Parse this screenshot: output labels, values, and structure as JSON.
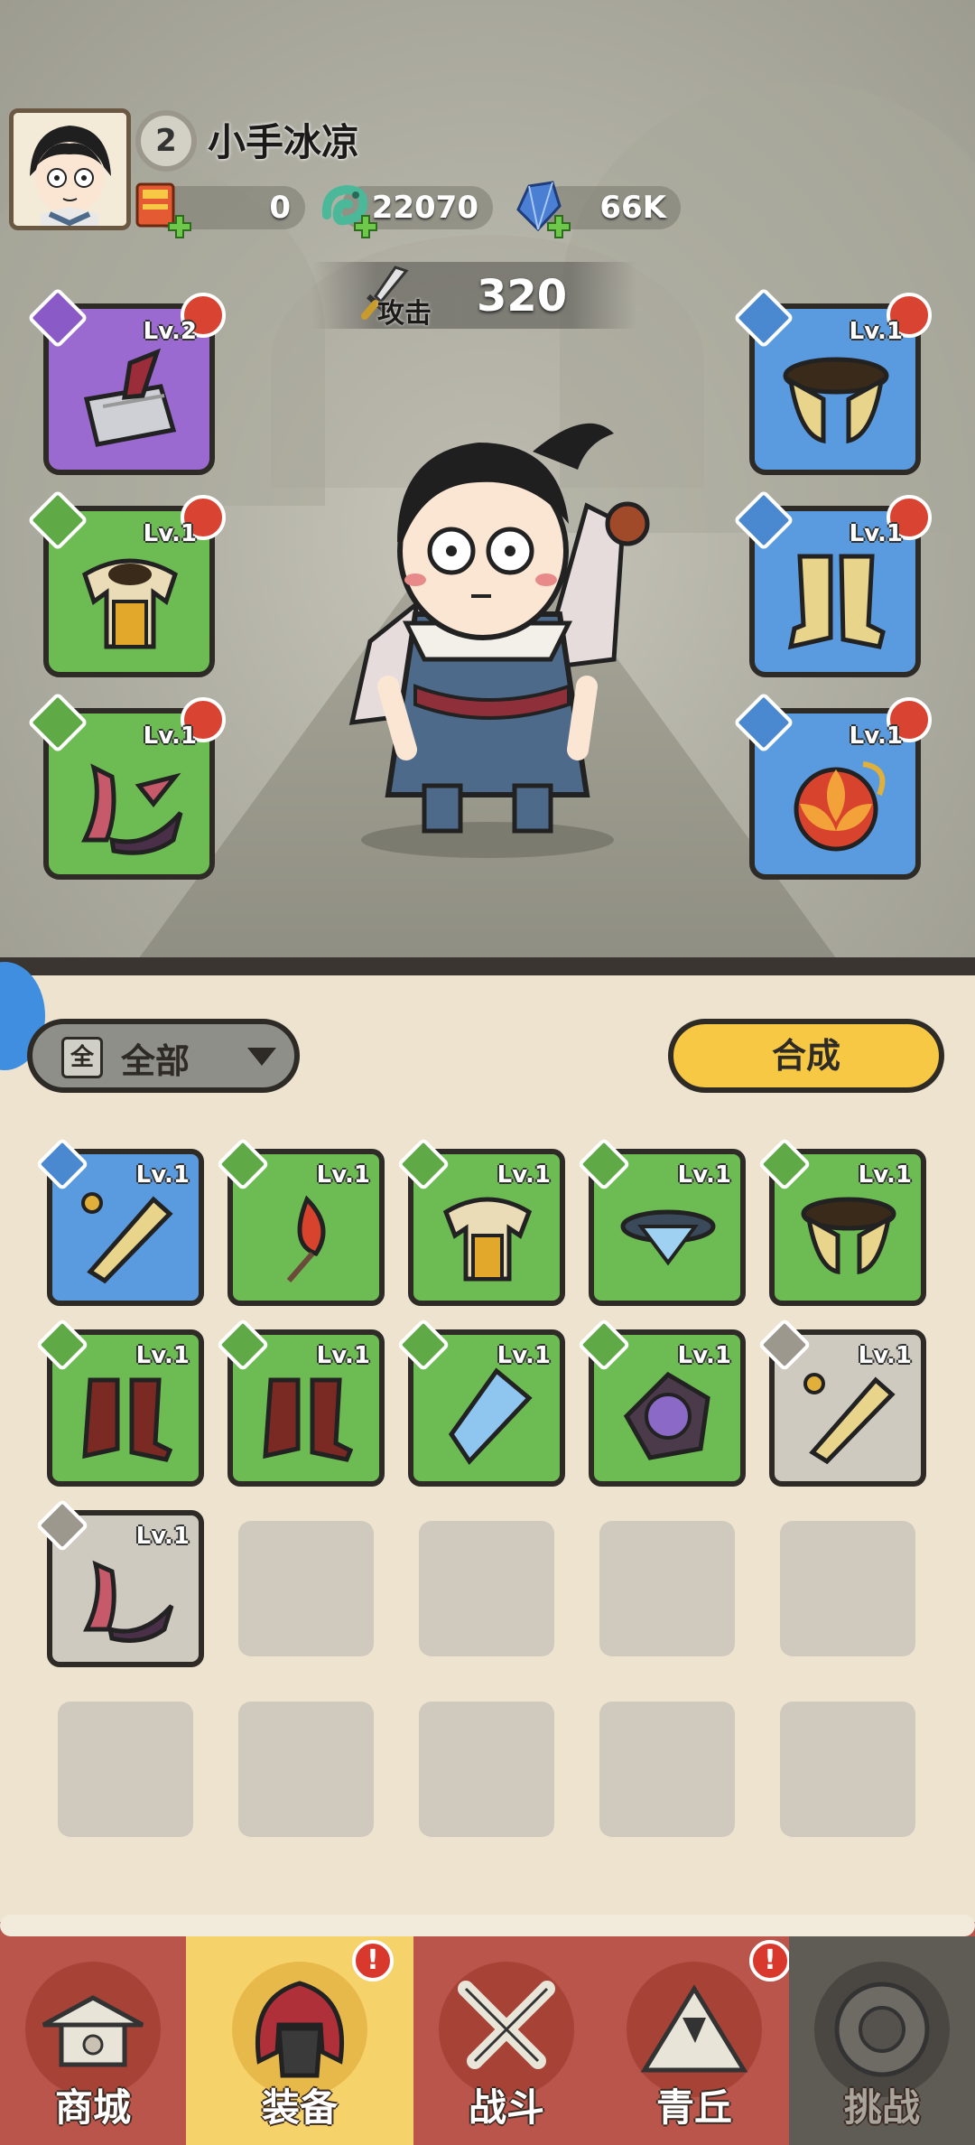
{
  "player": {
    "name": "小手冰凉",
    "level": "2"
  },
  "resources": [
    {
      "icon": "scroll-coupon-icon",
      "value": "0"
    },
    {
      "icon": "jade-dragon-icon",
      "value": "22070"
    },
    {
      "icon": "crystal-gem-icon",
      "value": "66K"
    }
  ],
  "attack": {
    "label": "攻击",
    "value": "320"
  },
  "equipped": {
    "weapon": {
      "level": "Lv.2",
      "rarity": "purple"
    },
    "armor": {
      "level": "Lv.1",
      "rarity": "green"
    },
    "headband": {
      "level": "Lv.1",
      "rarity": "green"
    },
    "belt": {
      "level": "Lv.1",
      "rarity": "blue"
    },
    "boots": {
      "level": "Lv.1",
      "rarity": "blue"
    },
    "accessory": {
      "level": "Lv.1",
      "rarity": "blue"
    }
  },
  "filter": {
    "glyph": "全",
    "label": "全部"
  },
  "merge_button": "合成",
  "inventory": [
    {
      "name": "golden-fan",
      "level": "Lv.1",
      "rarity": "blue"
    },
    {
      "name": "red-tassel",
      "level": "Lv.1",
      "rarity": "green"
    },
    {
      "name": "golden-armor",
      "level": "Lv.1",
      "rarity": "green"
    },
    {
      "name": "ice-belt",
      "level": "Lv.1",
      "rarity": "green"
    },
    {
      "name": "gold-belt",
      "level": "Lv.1",
      "rarity": "green"
    },
    {
      "name": "red-boots",
      "level": "Lv.1",
      "rarity": "green"
    },
    {
      "name": "red-boots",
      "level": "Lv.1",
      "rarity": "green"
    },
    {
      "name": "ice-pendant",
      "level": "Lv.1",
      "rarity": "green"
    },
    {
      "name": "purple-orb",
      "level": "Lv.1",
      "rarity": "green"
    },
    {
      "name": "golden-fan",
      "level": "Lv.1",
      "rarity": "gray"
    },
    {
      "name": "horn-headband",
      "level": "Lv.1",
      "rarity": "gray"
    }
  ],
  "nav": [
    {
      "label": "商城",
      "icon": "shop-pagoda-icon",
      "active": false
    },
    {
      "label": "装备",
      "icon": "helmet-icon",
      "active": true,
      "badge": "!"
    },
    {
      "label": "战斗",
      "icon": "crossed-swords-icon",
      "active": false
    },
    {
      "label": "青丘",
      "icon": "mountain-icon",
      "active": false,
      "badge": "!"
    },
    {
      "label": "挑战",
      "icon": "locked-orb-icon",
      "active": false,
      "locked": true
    }
  ],
  "colors": {
    "purple": "#9a6ad0",
    "green": "#6dbb53",
    "blue": "#5a9be0",
    "gold": "#f6c843",
    "nav": "#b9554b"
  }
}
